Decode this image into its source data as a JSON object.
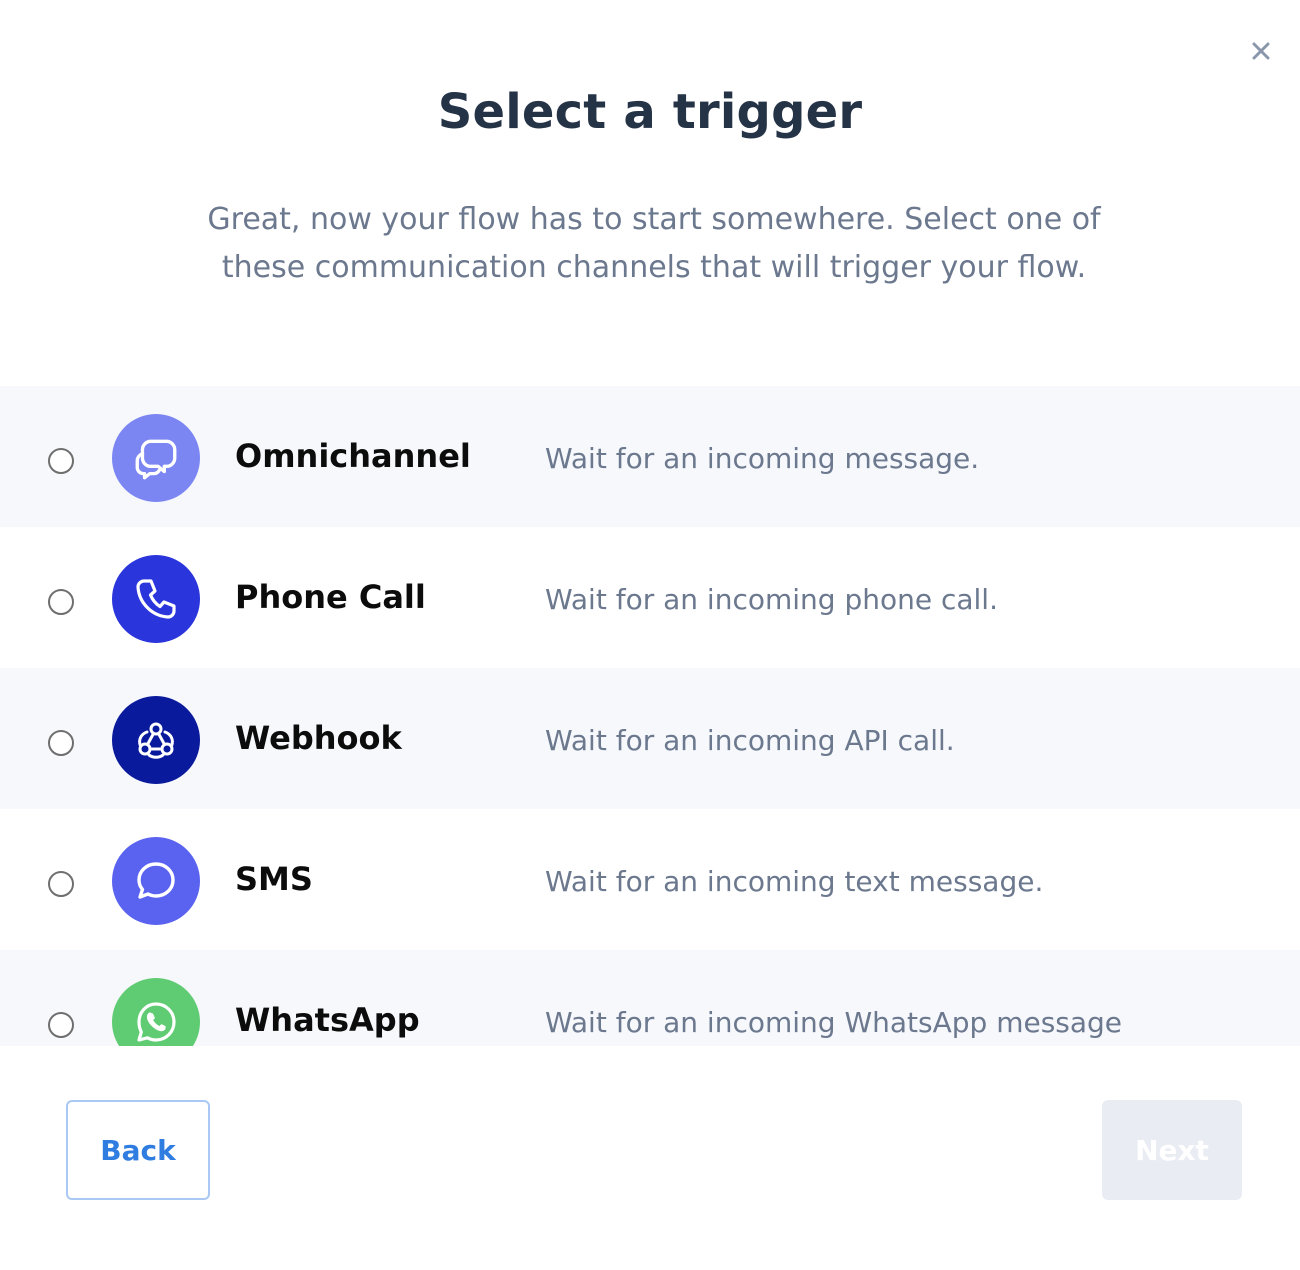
{
  "dialog": {
    "title": "Select a trigger",
    "subtitle": "Great, now your flow has to start somewhere. Select one of these communication channels that will trigger your flow.",
    "close_icon": "close-icon"
  },
  "options": [
    {
      "label": "Omnichannel",
      "description": "Wait for an incoming message.",
      "icon": "chat-bubbles-icon",
      "icon_color": "#7b86f2",
      "selected": false
    },
    {
      "label": "Phone Call",
      "description": "Wait for an incoming phone call.",
      "icon": "phone-icon",
      "icon_color": "#2a35dc",
      "selected": false
    },
    {
      "label": "Webhook",
      "description": "Wait for an incoming API call.",
      "icon": "webhook-icon",
      "icon_color": "#0a1a9c",
      "selected": false
    },
    {
      "label": "SMS",
      "description": "Wait for an incoming text message.",
      "icon": "message-bubble-icon",
      "icon_color": "#5a63f0",
      "selected": false
    },
    {
      "label": "WhatsApp",
      "description": "Wait for an incoming WhatsApp message",
      "icon": "whatsapp-icon",
      "icon_color": "#5fcb72",
      "selected": false
    }
  ],
  "footer": {
    "back_label": "Back",
    "next_label": "Next",
    "next_disabled": true
  },
  "colors": {
    "title": "#253347",
    "muted_text": "#6b788e",
    "row_shade": "#f6f8fc",
    "back_text": "#2f7de1",
    "back_border": "#aac8f4",
    "next_disabled_bg": "#e9edf3"
  }
}
